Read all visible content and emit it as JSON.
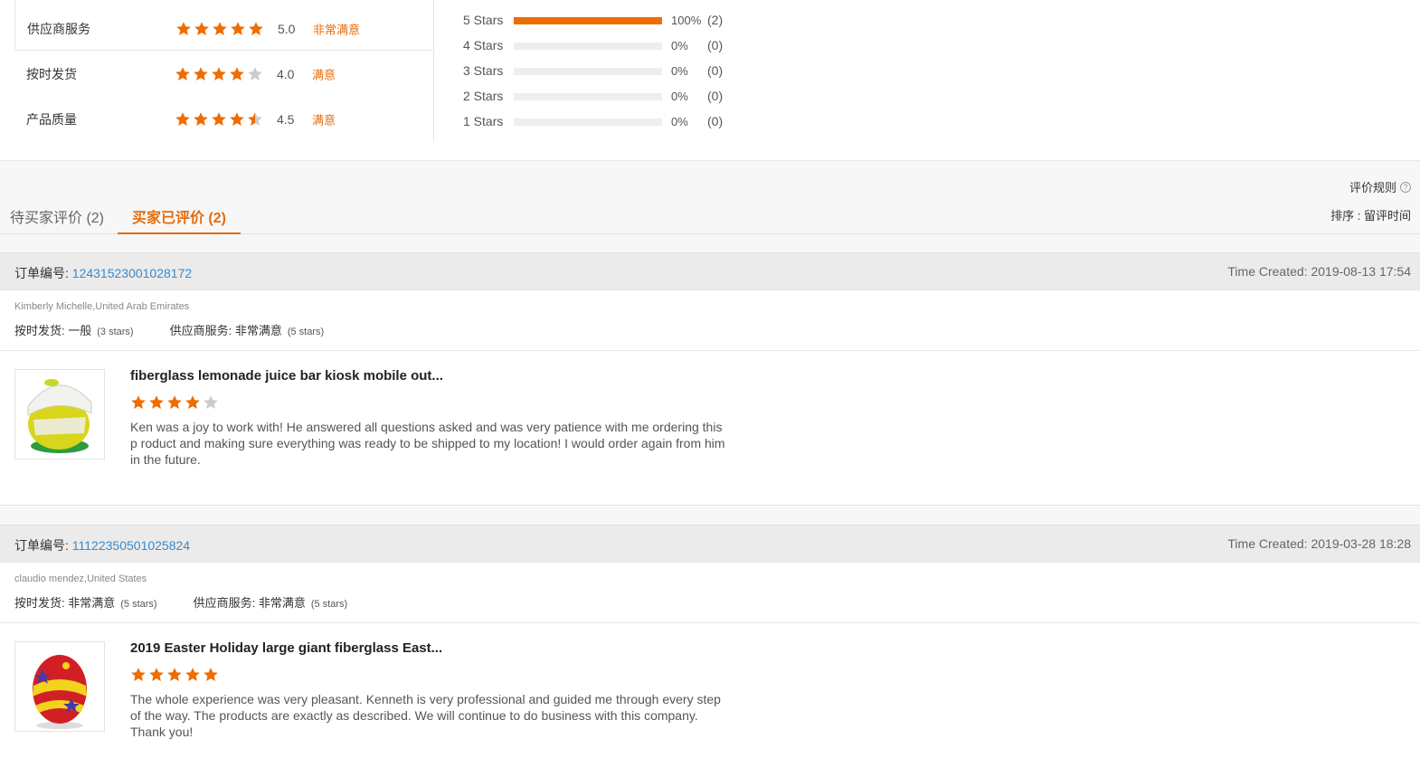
{
  "ratings": [
    {
      "label": "供应商服务",
      "score": "5.0",
      "text": "非常满意",
      "stars": 5
    },
    {
      "label": "按时发货",
      "score": "4.0",
      "text": "满意",
      "stars": 4
    },
    {
      "label": "产品质量",
      "score": "4.5",
      "text": "满意",
      "stars": 4.5
    }
  ],
  "distribution": [
    {
      "label": "5 Stars",
      "percent_text": "100%",
      "count": "(2)",
      "fill": 1.0
    },
    {
      "label": "4 Stars",
      "percent_text": "0%",
      "count": "(0)",
      "fill": 0
    },
    {
      "label": "3 Stars",
      "percent_text": "0%",
      "count": "(0)",
      "fill": 0
    },
    {
      "label": "2 Stars",
      "percent_text": "0%",
      "count": "(0)",
      "fill": 0
    },
    {
      "label": "1 Stars",
      "percent_text": "0%",
      "count": "(0)",
      "fill": 0
    }
  ],
  "tabs": {
    "pending": "待买家评价 (2)",
    "reviewed": "买家已评价 (2)"
  },
  "rules_label": "评价规则",
  "sort_label": "排序 : 留评时间",
  "colors": {
    "accent": "#e66c0c",
    "star": "#ef6c00",
    "star_empty": "#cccccc",
    "link": "#3a89c9"
  },
  "reviews": [
    {
      "order_label": "订单编号: ",
      "order_no": "12431523001028172",
      "time": "Time Created: 2019-08-13 17:54",
      "buyer": "Kimberly Michelle,United Arab Emirates",
      "shipping_label": "按时发货: ",
      "shipping_value": "一般",
      "shipping_stars": "(3 stars)",
      "service_label": "供应商服务: ",
      "service_value": "非常满意",
      "service_stars": "(5 stars)",
      "product_title": "fiberglass lemonade juice bar kiosk mobile out...",
      "product_stars": 4,
      "product_icon": "lemon-kiosk-image",
      "comment": "Ken was a joy to work with! He answered all questions asked and was very patience with me ordering this p roduct and making sure everything was ready to be shipped to my location! I would order again from him in the future."
    },
    {
      "order_label": "订单编号: ",
      "order_no": "11122350501025824",
      "time": "Time Created: 2019-03-28 18:28",
      "buyer": "claudio mendez,United States",
      "shipping_label": "按时发货: ",
      "shipping_value": "非常满意",
      "shipping_stars": "(5 stars)",
      "service_label": "供应商服务: ",
      "service_value": "非常满意",
      "service_stars": "(5 stars)",
      "product_title": "2019 Easter Holiday large giant fiberglass East...",
      "product_stars": 5,
      "product_icon": "easter-egg-image",
      "comment": "The whole experience was very pleasant. Kenneth is very professional and guided me through every step of the way. The products are exactly as described. We will continue to do business with this company. Thank you!"
    }
  ]
}
